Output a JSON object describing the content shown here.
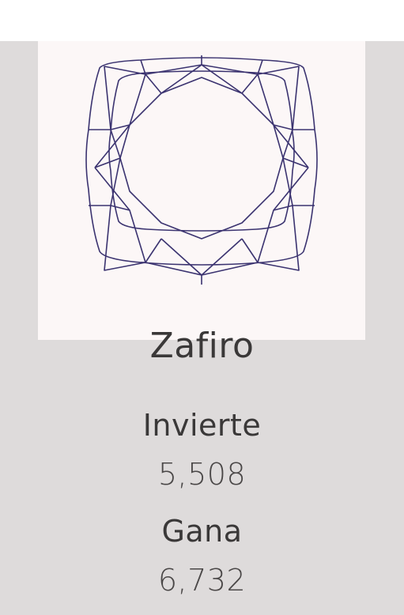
{
  "gem": {
    "name": "Zafiro",
    "icon": "cushion-cut-gem-icon",
    "outline_color": "#3b3370"
  },
  "invest": {
    "label": "Invierte",
    "value": "5,508"
  },
  "gain": {
    "label": "Gana",
    "value": "6,732"
  },
  "colors": {
    "card_background": "#dedbdb",
    "gem_panel_background": "#fcf7f7",
    "text": "#3a3838"
  }
}
